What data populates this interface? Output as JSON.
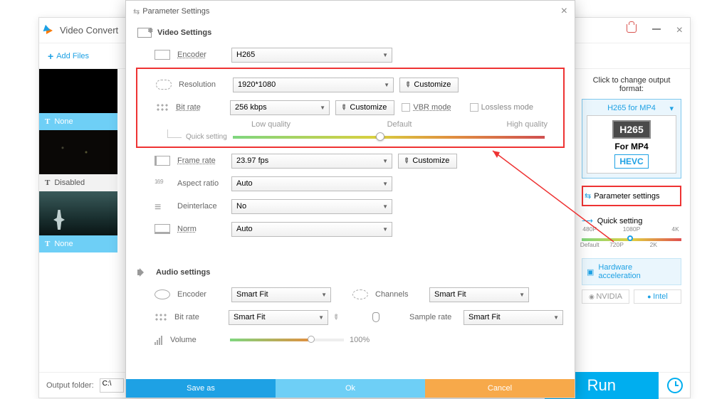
{
  "app": {
    "title": "Video Convert"
  },
  "toolbar": {
    "add_files": "Add Files"
  },
  "thumbs": [
    {
      "label": "None"
    },
    {
      "label": "Disabled"
    },
    {
      "label": "None"
    }
  ],
  "bottom": {
    "folder_label": "Output folder:",
    "folder_value": "C:\\",
    "run": "Run"
  },
  "right": {
    "title": "Click to change output format:",
    "format_name": "H265 for MP4",
    "codec_badge": "H265",
    "for_label": "For MP4",
    "hevc": "HEVC",
    "param_btn": "Parameter settings",
    "quick": "Quick setting",
    "ticks_top": [
      "480P",
      "1080P",
      "4K"
    ],
    "ticks_bot": [
      "Default",
      "720P",
      "2K"
    ],
    "hw": "Hardware acceleration",
    "nvidia": "NVIDIA",
    "intel": "Intel"
  },
  "dialog": {
    "title": "Parameter Settings",
    "video_h": "Video Settings",
    "audio_h": "Audio settings",
    "rows": {
      "encoder": {
        "label": "Encoder",
        "value": "H265"
      },
      "resolution": {
        "label": "Resolution",
        "value": "1920*1080"
      },
      "bitrate": {
        "label": "Bit rate",
        "value": "256 kbps"
      },
      "vbr": "VBR mode",
      "lossless": "Lossless mode",
      "quick": "Quick setting",
      "qlow": "Low quality",
      "qdef": "Default",
      "qhigh": "High quality",
      "framerate": {
        "label": "Frame rate",
        "value": "23.97 fps"
      },
      "aspect": {
        "label": "Aspect ratio",
        "value": "Auto"
      },
      "deint": {
        "label": "Deinterlace",
        "value": "No"
      },
      "norm": {
        "label": "Norm",
        "value": "Auto"
      },
      "a_encoder": {
        "label": "Encoder",
        "value": "Smart Fit"
      },
      "a_bitrate": {
        "label": "Bit rate",
        "value": "Smart Fit"
      },
      "channels": {
        "label": "Channels",
        "value": "Smart Fit"
      },
      "sample": {
        "label": "Sample rate",
        "value": "Smart Fit"
      },
      "volume": {
        "label": "Volume",
        "value": "100%"
      }
    },
    "customize": "Customize",
    "buttons": {
      "save": "Save as",
      "ok": "Ok",
      "cancel": "Cancel"
    }
  }
}
